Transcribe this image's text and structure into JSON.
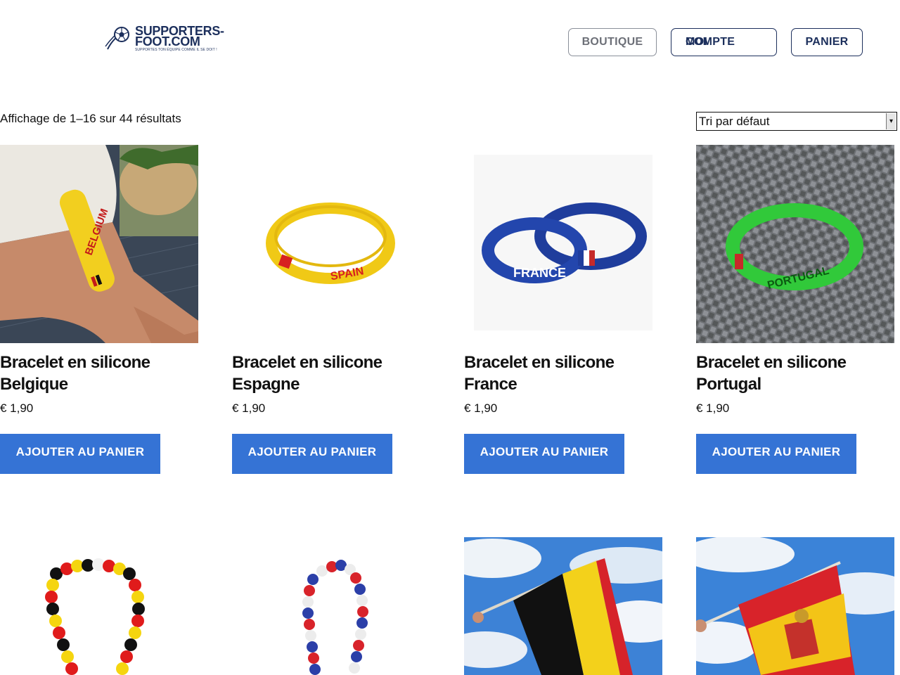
{
  "header": {
    "logo": {
      "line1": "SUPPORTERS-",
      "line2": "FOOT.COM",
      "tagline": "SUPPORTES TON ÉQUIPE COMME IL SE DOIT !"
    },
    "nav": {
      "boutique": "BOUTIQUE",
      "moi": "MOI",
      "compte": "COMPTE",
      "panier": "PANIER"
    }
  },
  "shop": {
    "result_count": "Affichage de 1–16 sur 44 résultats",
    "sort": {
      "selected": "Tri par défaut"
    }
  },
  "products": [
    {
      "title": "Bracelet en silicone Belgique",
      "price": "€ 1,90",
      "button": "AJOUTER AU PANIER",
      "image_text": "BELGIUM"
    },
    {
      "title": "Bracelet en silicone Espagne",
      "price": "€ 1,90",
      "button": "AJOUTER AU PANIER",
      "image_text": "SPAIN"
    },
    {
      "title": "Bracelet en silicone France",
      "price": "€ 1,90",
      "button": "AJOUTER AU PANIER",
      "image_text": "FRANCE"
    },
    {
      "title": "Bracelet en silicone Portugal",
      "price": "€ 1,90",
      "button": "AJOUTER AU PANIER",
      "image_text": "PORTUGAL"
    },
    {},
    {},
    {},
    {}
  ],
  "colors": {
    "accent": "#3573d5",
    "brand_navy": "#1c2f5c"
  }
}
